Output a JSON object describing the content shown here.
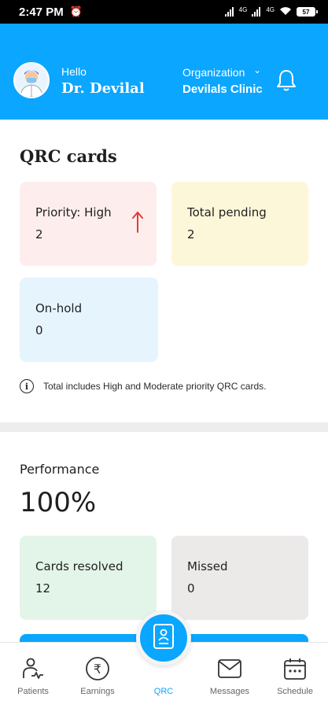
{
  "status_bar": {
    "time": "2:47 PM",
    "signal_1_label": "4G",
    "signal_2_label": "4G",
    "battery": "57"
  },
  "header": {
    "greeting": "Hello",
    "doctor_name": "Dr. Devilal",
    "org_label": "Organization",
    "org_name": "Devilals Clinic",
    "bg_color": "#0aa6ff"
  },
  "qrc": {
    "title": "QRC cards",
    "cards": [
      {
        "label": "Priority: High",
        "value": "2",
        "color": "#fdeeed"
      },
      {
        "label": "Total pending",
        "value": "2",
        "color": "#fdf7d9"
      },
      {
        "label": "On-hold",
        "value": "0",
        "color": "#e6f4fe"
      }
    ],
    "info_note": "Total includes High and Moderate priority QRC cards."
  },
  "performance": {
    "title": "Performance",
    "value": "100%",
    "cards": [
      {
        "label": "Cards resolved",
        "value": "12",
        "color": "#e3f5e9"
      },
      {
        "label": "Missed",
        "value": "0",
        "color": "#eceae9"
      }
    ]
  },
  "bottom_nav": {
    "items": [
      {
        "label": "Patients",
        "icon": "patients-icon"
      },
      {
        "label": "Earnings",
        "icon": "rupee-icon"
      },
      {
        "label": "QRC",
        "icon": "qrc-card-icon",
        "active": true
      },
      {
        "label": "Messages",
        "icon": "mail-icon"
      },
      {
        "label": "Schedule",
        "icon": "calendar-icon"
      }
    ],
    "active_color": "#0aa6ff"
  }
}
